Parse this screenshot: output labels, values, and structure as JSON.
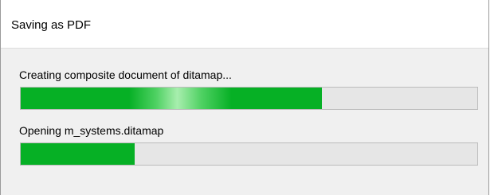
{
  "window": {
    "title": "Saving as PDF"
  },
  "tasks": [
    {
      "label": "Creating composite document of ditamap...",
      "progress": 0.66
    },
    {
      "label": "Opening m_systems.ditamap",
      "progress": 0.25
    }
  ],
  "colors": {
    "progress_fill": "#06b025",
    "progress_track": "#e6e6e6"
  }
}
